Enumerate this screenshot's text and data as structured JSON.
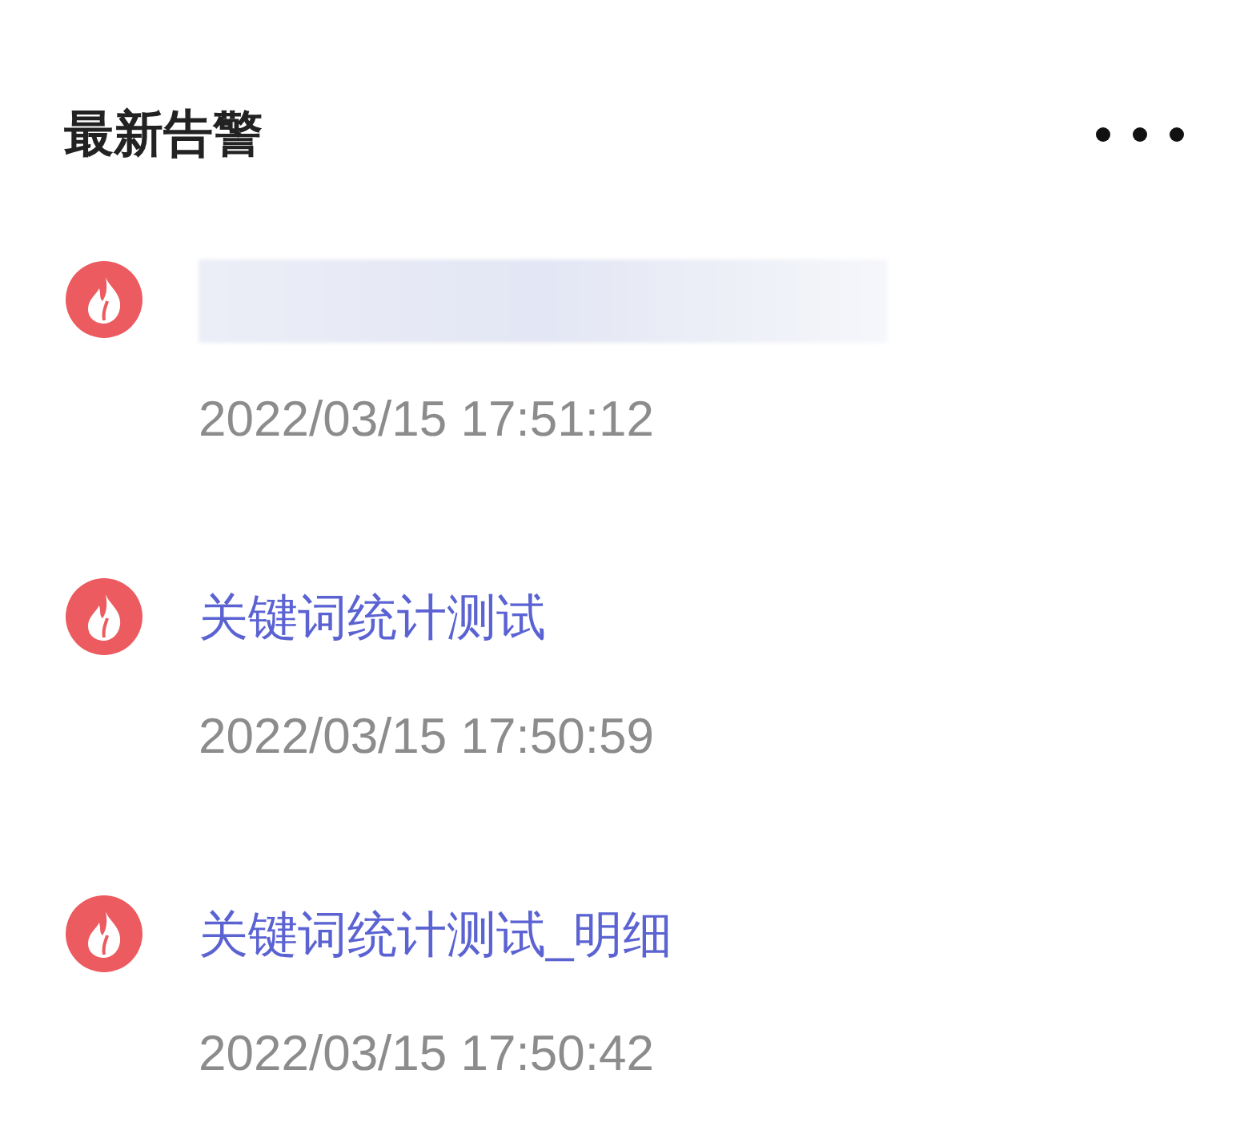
{
  "header": {
    "title": "最新告警"
  },
  "alerts": [
    {
      "kind": "redacted",
      "time": "2022/03/15 17:51:12"
    },
    {
      "kind": "link",
      "title": "关键词统计测试",
      "time": "2022/03/15 17:50:59"
    },
    {
      "kind": "link",
      "title": "关键词统计测试_明细",
      "time": "2022/03/15 17:50:42"
    }
  ]
}
